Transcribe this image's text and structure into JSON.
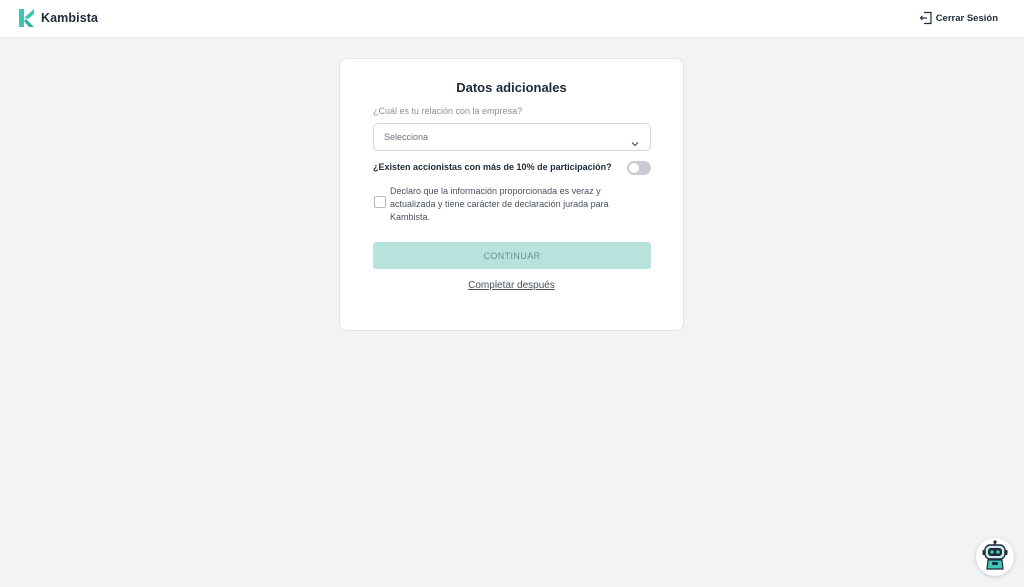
{
  "header": {
    "brand": "Kambista",
    "logout_label": "Cerrar Sesión"
  },
  "form": {
    "title": "Datos adicionales",
    "relation_label": "¿Cuál es tu relación con la empresa?",
    "relation_select": {
      "value": "Selecciona"
    },
    "shareholders_question": "¿Existen accionistas con más de 10% de participación?",
    "shareholders_toggle_on": false,
    "declaration_checked": false,
    "declaration_text": "Declaro que la información proporcionada es veraz y actualizada y tiene carácter de declaración jurada para Kambista.",
    "continue_label": "CONTINUAR",
    "complete_later_label": "Completar después"
  },
  "colors": {
    "brand_accent": "#3ec6b5",
    "continue_button_disabled": "#b8e2dc",
    "page_background": "#f3f3f6"
  },
  "icons": [
    "kambista-logo-icon",
    "logout-icon",
    "chevron-down-icon",
    "chatbot-robot-icon"
  ]
}
